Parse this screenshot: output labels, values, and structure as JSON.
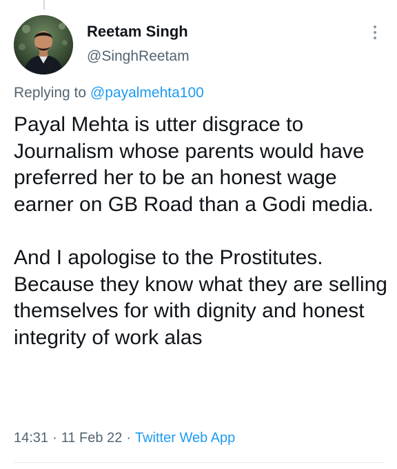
{
  "author": {
    "name": "Reetam Singh",
    "handle": "@SinghReetam"
  },
  "reply": {
    "prefix": "Replying to",
    "mention": "@payalmehta100"
  },
  "tweet": {
    "paragraphs": [
      "Payal Mehta is utter disgrace to Journalism whose parents would have preferred her to be an honest wage earner on GB Road than a Godi media.",
      "And I apologise to the Prostitutes. Because they know what they are selling themselves for with dignity and honest integrity of work alas"
    ]
  },
  "meta": {
    "time": "14:31",
    "separator": "·",
    "date": "11 Feb 22",
    "source": "Twitter Web App"
  },
  "icons": {
    "more": "more-vertical-icon"
  },
  "colors": {
    "text": "#0f1419",
    "secondary": "#536471",
    "accent": "#1d9bf0"
  }
}
